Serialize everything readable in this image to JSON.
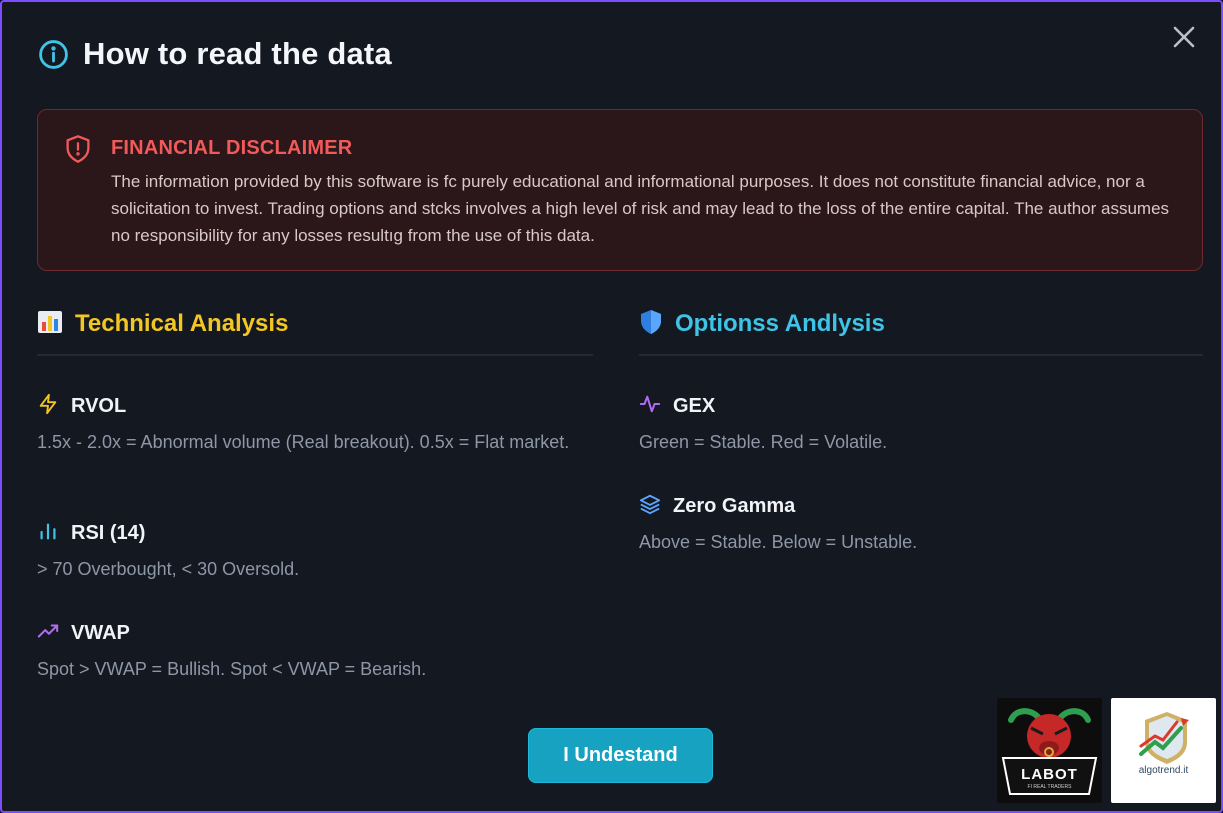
{
  "dialog": {
    "title": "How to read the data",
    "close_icon": "close-icon",
    "border_color": "#7c4dff"
  },
  "disclaimer": {
    "title": "FINANCIAL DISCLAIMER",
    "text": "The information provided by this software is fc purely educational and informational purposes. It does not constitute financial advice, nor a solicitation to invest. Trading options and stcks involves a high level of risk and may lead to the loss of the entire capital. The author assumes no responsibility for any losses resultıg from the use of this data.",
    "icon": "shield-alert-icon",
    "accent": "#f05a5a"
  },
  "technical": {
    "heading": "Technical Analysis",
    "icon": "bar-chart-icon",
    "accent": "#f3c623",
    "items": [
      {
        "title": "RVOL",
        "icon": "lightning-icon",
        "desc": "1.5x - 2.0x = Abnormal volume (Real breakout). 0.5x = Flat market."
      },
      {
        "title": "RSI (14)",
        "icon": "bars-icon",
        "desc": "> 70 Overbought, < 30 Oversold."
      },
      {
        "title": "VWAP",
        "icon": "trend-up-icon",
        "desc": "Spot > VWAP = Bullish. Spot < VWAP = Bearish."
      }
    ]
  },
  "options": {
    "heading": "Optionss Andlysis",
    "icon": "shield-icon",
    "accent": "#3fc3e6",
    "items": [
      {
        "title": "GEX",
        "icon": "pulse-icon",
        "desc": "Green = Stable. Red = Volatile."
      },
      {
        "title": "Zero Gamma",
        "icon": "layers-icon",
        "desc": "Above = Stable. Below = Unstable."
      }
    ]
  },
  "cta": {
    "label": "I Undestand",
    "color": "#17a2c2"
  },
  "logos": {
    "labot": {
      "name": "LABOT",
      "tagline": "FI REAL TRADERS"
    },
    "algotrend": {
      "name": "algotrend.it"
    }
  }
}
